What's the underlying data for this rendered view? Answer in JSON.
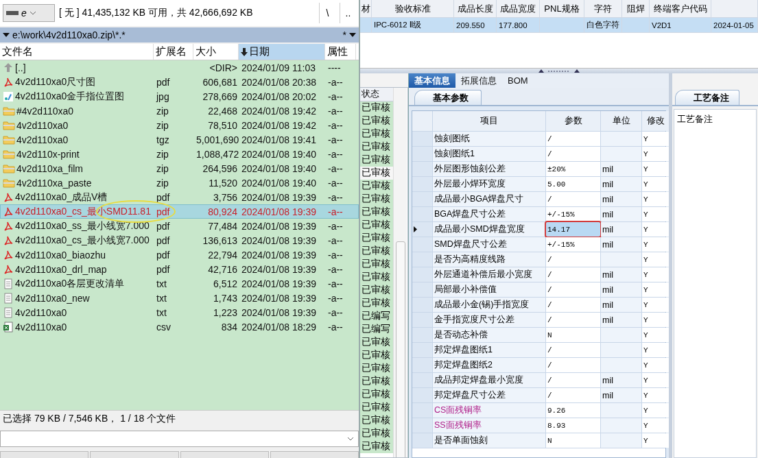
{
  "file_manager": {
    "drive": "e",
    "free_space": "[ 无 ]  41,435,132 KB 可用，共 42,666,692 KB",
    "root_button": "\\",
    "up_button": "..",
    "path": "e:\\work\\4v2d110xa0.zip\\*.*",
    "filter": "*",
    "columns": [
      {
        "label": "文件名",
        "selected": false
      },
      {
        "label": "扩展名",
        "selected": false
      },
      {
        "label": "大小",
        "selected": false
      },
      {
        "label": "日期",
        "selected": true
      },
      {
        "label": "属性",
        "selected": false
      }
    ],
    "files": [
      {
        "name": "[..]",
        "size": "<DIR>",
        "date": "2024/01/09 11:03",
        "attr": "----",
        "kind": "up",
        "selected": false,
        "annotated": false
      },
      {
        "name": "4v2d110xa0尺寸图",
        "ext": "pdf",
        "size": "606,681",
        "date": "2024/01/08 20:38",
        "attr": "-a--",
        "kind": "pdf",
        "selected": false,
        "annotated": false
      },
      {
        "name": "4v2d110xa0金手指位置图",
        "ext": "jpg",
        "size": "278,669",
        "date": "2024/01/08 20:02",
        "attr": "-a--",
        "kind": "image",
        "selected": false,
        "annotated": false
      },
      {
        "name": "#4v2d110xa0",
        "ext": "zip",
        "size": "22,468",
        "date": "2024/01/08 19:42",
        "attr": "-a--",
        "kind": "archive",
        "selected": false,
        "annotated": false
      },
      {
        "name": "4v2d110xa0",
        "ext": "zip",
        "size": "78,510",
        "date": "2024/01/08 19:42",
        "attr": "-a--",
        "kind": "archive",
        "selected": false,
        "annotated": false
      },
      {
        "name": "4v2d110xa0",
        "ext": "tgz",
        "size": "5,001,690",
        "date": "2024/01/08 19:41",
        "attr": "-a--",
        "kind": "archive",
        "selected": false,
        "annotated": false
      },
      {
        "name": "4v2d110x-print",
        "ext": "zip",
        "size": "1,088,472",
        "date": "2024/01/08 19:40",
        "attr": "-a--",
        "kind": "archive",
        "selected": false,
        "annotated": false
      },
      {
        "name": "4v2d110xa_film",
        "ext": "zip",
        "size": "264,596",
        "date": "2024/01/08 19:40",
        "attr": "-a--",
        "kind": "archive",
        "selected": false,
        "annotated": false
      },
      {
        "name": "4v2d110xa_paste",
        "ext": "zip",
        "size": "11,520",
        "date": "2024/01/08 19:40",
        "attr": "-a--",
        "kind": "archive",
        "selected": false,
        "annotated": false
      },
      {
        "name": "4v2d110xa0_成品V槽",
        "ext": "pdf",
        "size": "3,756",
        "date": "2024/01/08 19:39",
        "attr": "-a--",
        "kind": "pdf",
        "selected": false,
        "annotated": false
      },
      {
        "name": "4v2d110xa0_cs_最小SMD11.81",
        "ext": "pdf",
        "size": "80,924",
        "date": "2024/01/08 19:39",
        "attr": "-a--",
        "kind": "pdf",
        "selected": true,
        "annotated": true
      },
      {
        "name": "4v2d110xa0_ss_最小线宽7.000",
        "ext": "pdf",
        "size": "77,484",
        "date": "2024/01/08 19:39",
        "attr": "-a--",
        "kind": "pdf",
        "selected": false,
        "annotated": false
      },
      {
        "name": "4v2d110xa0_cs_最小线宽7.000",
        "ext": "pdf",
        "size": "136,613",
        "date": "2024/01/08 19:39",
        "attr": "-a--",
        "kind": "pdf",
        "selected": false,
        "annotated": false
      },
      {
        "name": "4v2d110xa0_biaozhu",
        "ext": "pdf",
        "size": "22,794",
        "date": "2024/01/08 19:39",
        "attr": "-a--",
        "kind": "pdf",
        "selected": false,
        "annotated": false
      },
      {
        "name": "4v2d110xa0_drl_map",
        "ext": "pdf",
        "size": "42,716",
        "date": "2024/01/08 19:39",
        "attr": "-a--",
        "kind": "pdf",
        "selected": false,
        "annotated": false
      },
      {
        "name": "4v2d110xa0各层更改清单",
        "ext": "txt",
        "size": "6,512",
        "date": "2024/01/08 19:39",
        "attr": "-a--",
        "kind": "text",
        "selected": false,
        "annotated": false
      },
      {
        "name": "4v2d110xa0_new",
        "ext": "txt",
        "size": "1,743",
        "date": "2024/01/08 19:39",
        "attr": "-a--",
        "kind": "text",
        "selected": false,
        "annotated": false
      },
      {
        "name": "4v2d110xa0",
        "ext": "txt",
        "size": "1,223",
        "date": "2024/01/08 19:39",
        "attr": "-a--",
        "kind": "text",
        "selected": false,
        "annotated": false
      },
      {
        "name": "4v2d110xa0",
        "ext": "csv",
        "size": "834",
        "date": "2024/01/08 18:29",
        "attr": "-a--",
        "kind": "spreadsheet",
        "selected": false,
        "annotated": false
      }
    ],
    "status": "已选择 79 KB / 7,546 KB， 1 / 18 个文件"
  },
  "record_table": {
    "columns": [
      "材",
      "验收标准",
      "成品长度",
      "成品宽度",
      "PNL规格",
      "字符",
      "阻焊",
      "终端客户代码"
    ],
    "rows": [
      {
        "cells": [
          null,
          "IPC-6012 Ⅱ级",
          "209.550",
          "177.800",
          null,
          "白色字符",
          null,
          "V2D1",
          "2024-01-05"
        ],
        "selected": true
      }
    ]
  },
  "status_list": {
    "header": "状态",
    "rows": [
      {
        "label": "已审核",
        "selected": false
      },
      {
        "label": "已审核",
        "selected": false
      },
      {
        "label": "已审核",
        "selected": false
      },
      {
        "label": "已审核",
        "selected": false
      },
      {
        "label": "已审核",
        "selected": false
      },
      {
        "label": "已审核",
        "selected": true
      },
      {
        "label": "已审核",
        "selected": false
      },
      {
        "label": "已审核",
        "selected": false
      },
      {
        "label": "已审核",
        "selected": false
      },
      {
        "label": "已审核",
        "selected": false
      },
      {
        "label": "已审核",
        "selected": false
      },
      {
        "label": "已审核",
        "selected": false
      },
      {
        "label": "已审核",
        "selected": false
      },
      {
        "label": "已审核",
        "selected": false
      },
      {
        "label": "已审核",
        "selected": false
      },
      {
        "label": "已审核",
        "selected": false
      },
      {
        "label": "已编写",
        "selected": false
      },
      {
        "label": "已编写",
        "selected": false
      },
      {
        "label": "已审核",
        "selected": false
      },
      {
        "label": "已审核",
        "selected": false
      },
      {
        "label": "已审核",
        "selected": false
      },
      {
        "label": "已审核",
        "selected": false
      },
      {
        "label": "已审核",
        "selected": false
      },
      {
        "label": "已审核",
        "selected": false
      },
      {
        "label": "已审核",
        "selected": false
      },
      {
        "label": "已审核",
        "selected": false
      },
      {
        "label": "已审核",
        "selected": false
      }
    ]
  },
  "detail": {
    "tabs": [
      {
        "label": "基本信息",
        "selected": true
      },
      {
        "label": "拓展信息",
        "selected": false
      },
      {
        "label": "BOM",
        "selected": false
      }
    ],
    "subtab": "基本参数",
    "columns": [
      "项目",
      "参数",
      "单位",
      "修改"
    ],
    "rows": [
      {
        "item": "蚀刻图纸",
        "value": "/",
        "modified": "Y",
        "current": false,
        "annotated": false
      },
      {
        "item": "蚀刻图纸1",
        "value": "/",
        "modified": "Y",
        "current": false,
        "annotated": false
      },
      {
        "item": "外层图形蚀刻公差",
        "value": "±20%",
        "unit": "mil",
        "modified": "Y",
        "current": false,
        "annotated": false
      },
      {
        "item": "外层最小焊环宽度",
        "value": "5.00",
        "unit": "mil",
        "modified": "Y",
        "current": false,
        "annotated": false
      },
      {
        "item": "成品最小BGA焊盘尺寸",
        "value": "/",
        "unit": "mil",
        "modified": "Y",
        "current": false,
        "annotated": false
      },
      {
        "item": "BGA焊盘尺寸公差",
        "value": "+/-15%",
        "unit": "mil",
        "modified": "Y",
        "current": false,
        "annotated": false
      },
      {
        "item": "成品最小SMD焊盘宽度",
        "value": "14.17",
        "unit": "mil",
        "modified": "Y",
        "current": true,
        "annotated": true
      },
      {
        "item": "SMD焊盘尺寸公差",
        "value": "+/-15%",
        "unit": "mil",
        "modified": "Y",
        "current": false,
        "annotated": false
      },
      {
        "item": "是否为高精度线路",
        "value": "/",
        "modified": "Y",
        "current": false,
        "annotated": false
      },
      {
        "item": "外层通道补偿后最小宽度",
        "value": "/",
        "unit": "mil",
        "modified": "Y",
        "current": false,
        "annotated": false
      },
      {
        "item": "局部最小补偿值",
        "value": "/",
        "unit": "mil",
        "modified": "Y",
        "current": false,
        "annotated": false
      },
      {
        "item": "成品最小金(锡)手指宽度",
        "value": "/",
        "unit": "mil",
        "modified": "Y",
        "current": false,
        "annotated": false
      },
      {
        "item": "金手指宽度尺寸公差",
        "value": "/",
        "unit": "mil",
        "modified": "Y",
        "current": false,
        "annotated": false
      },
      {
        "item": "是否动态补偿",
        "value": "N",
        "modified": "Y",
        "current": false,
        "annotated": false
      },
      {
        "item": "邦定焊盘图纸1",
        "value": "/",
        "modified": "Y",
        "current": false,
        "annotated": false
      },
      {
        "item": "邦定焊盘图纸2",
        "value": "/",
        "modified": "Y",
        "current": false,
        "annotated": false
      },
      {
        "item": "成品邦定焊盘最小宽度",
        "value": "/",
        "unit": "mil",
        "modified": "Y",
        "current": false,
        "annotated": false
      },
      {
        "item": "邦定焊盘尺寸公差",
        "value": "/",
        "unit": "mil",
        "modified": "Y",
        "current": false,
        "annotated": false
      },
      {
        "item": "CS面残铜率",
        "value": "9.26",
        "modified": "Y",
        "current": false,
        "annotated": false,
        "color": "#b0208a"
      },
      {
        "item": "SS面残铜率",
        "value": "8.93",
        "modified": "Y",
        "current": false,
        "annotated": false,
        "color": "#b0208a"
      },
      {
        "item": "是否单面蚀刻",
        "value": "N",
        "modified": "Y",
        "current": false,
        "annotated": false
      }
    ]
  },
  "notes": {
    "tab": "工艺备注",
    "title": "工艺备注"
  }
}
